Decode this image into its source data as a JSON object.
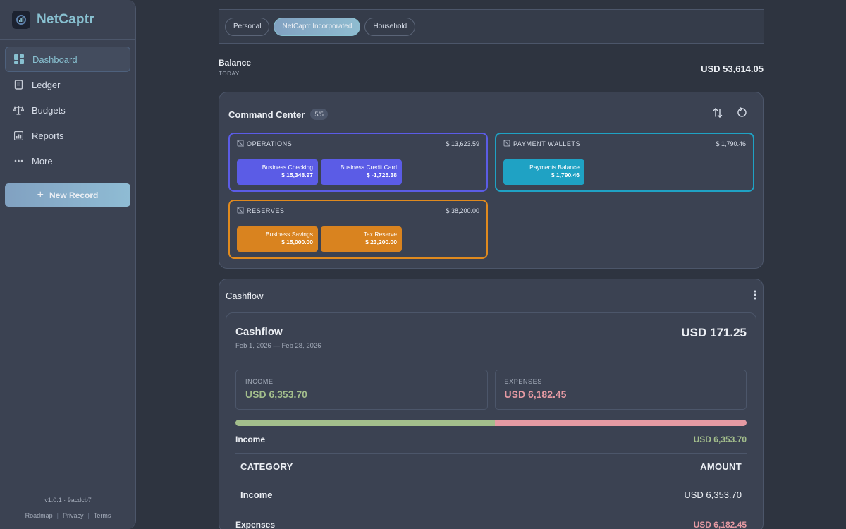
{
  "app": {
    "name": "NetCaptr"
  },
  "sidebar": {
    "items": [
      {
        "label": "Dashboard",
        "icon": "dashboard-icon",
        "active": true
      },
      {
        "label": "Ledger",
        "icon": "ledger-icon"
      },
      {
        "label": "Budgets",
        "icon": "scale-icon"
      },
      {
        "label": "Reports",
        "icon": "reports-icon"
      },
      {
        "label": "More",
        "icon": "more-icon"
      }
    ],
    "new_record_label": "New Record",
    "version": "v1.0.1 · 9acdcb7",
    "footer_links": [
      "Roadmap",
      "Privacy",
      "Terms"
    ]
  },
  "tabs": [
    {
      "label": "Personal"
    },
    {
      "label": "NetCaptr Incorporated",
      "active": true
    },
    {
      "label": "Household"
    }
  ],
  "balance": {
    "title": "Balance",
    "subtitle": "TODAY",
    "amount": "USD 53,614.05"
  },
  "command_center": {
    "title": "Command Center",
    "badge": "5/5",
    "groups": [
      {
        "name": "OPERATIONS",
        "total": "$ 13,623.59",
        "color": "#5b5ce6",
        "accounts": [
          {
            "name": "Business Checking",
            "value": "$ 15,348.97"
          },
          {
            "name": "Business Credit Card",
            "value": "$ -1,725.38"
          }
        ]
      },
      {
        "name": "PAYMENT WALLETS",
        "total": "$ 1,790.46",
        "color": "#1fa2c4",
        "accounts": [
          {
            "name": "Payments Balance",
            "value": "$ 1,790.46"
          }
        ]
      },
      {
        "name": "RESERVES",
        "total": "$ 38,200.00",
        "color": "#e08a1e",
        "accounts": [
          {
            "name": "Business Savings",
            "value": "$ 15,000.00"
          },
          {
            "name": "Tax Reserve",
            "value": "$ 23,200.00"
          }
        ]
      }
    ]
  },
  "cashflow": {
    "section_title": "Cashflow",
    "title": "Cashflow",
    "range": "Feb 1, 2026 — Feb 28, 2026",
    "total": "USD 171.25",
    "income": {
      "label": "INCOME",
      "value": "USD 6,353.70",
      "color": "#a3be8c"
    },
    "expenses": {
      "label": "EXPENSES",
      "value": "USD 6,182.45",
      "color": "#e59aa3"
    },
    "income_share": 0.507,
    "income_line": {
      "label": "Income",
      "value": "USD 6,353.70"
    },
    "table": {
      "col_category": "CATEGORY",
      "col_amount": "AMOUNT",
      "rows": [
        {
          "category": "Income",
          "amount": "USD 6,353.70"
        }
      ]
    },
    "expenses_line": {
      "label": "Expenses",
      "value": "USD 6,182.45"
    }
  }
}
